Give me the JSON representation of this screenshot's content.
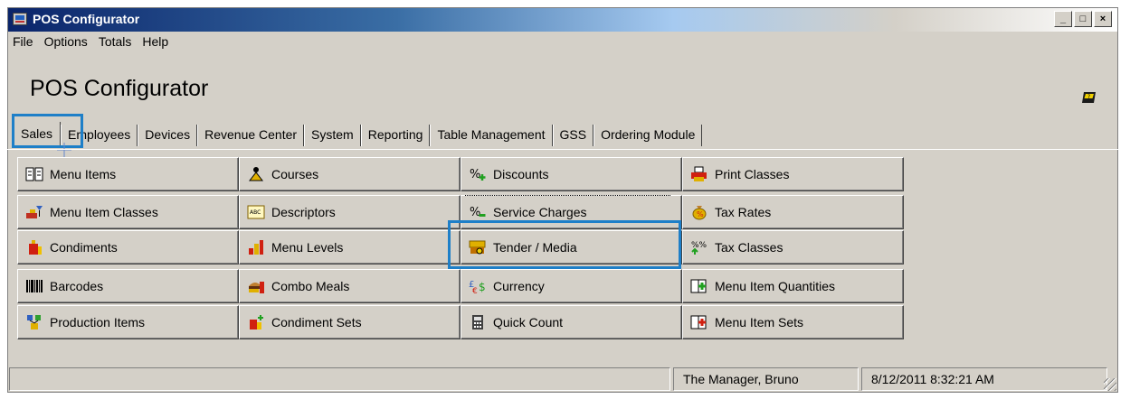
{
  "window": {
    "title": "POS Configurator",
    "minimize_glyph": "_",
    "maximize_glyph": "□",
    "close_glyph": "×"
  },
  "menubar": [
    "File",
    "Options",
    "Totals",
    "Help"
  ],
  "app_title": "POS Configurator",
  "tabs": [
    "Sales",
    "Employees",
    "Devices",
    "Revenue Center",
    "System",
    "Reporting",
    "Table Management",
    "GSS",
    "Ordering Module"
  ],
  "buttons": {
    "col1": [
      "Menu Items",
      "Menu Item Classes",
      "Condiments",
      "Barcodes",
      "Production Items"
    ],
    "col2": [
      "Courses",
      "Descriptors",
      "Menu Levels",
      "Combo Meals",
      "Condiment Sets"
    ],
    "col3": [
      "Discounts",
      "Service Charges",
      "Tender / Media",
      "Currency",
      "Quick Count"
    ],
    "col4": [
      "Print Classes",
      "Tax Rates",
      "Tax Classes",
      "Menu Item Quantities",
      "Menu Item Sets"
    ]
  },
  "status": {
    "user": "The Manager, Bruno",
    "datetime": "8/12/2011 8:32:21 AM"
  },
  "colors": {
    "highlight": "#1e7fc8",
    "titlebar": "#0a246a",
    "face": "#d4d0c8"
  }
}
